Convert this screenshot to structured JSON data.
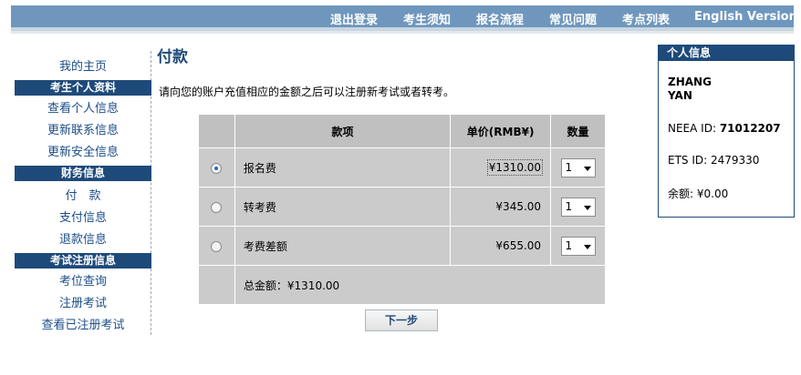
{
  "nav": {
    "items": [
      "退出登录",
      "考生须知",
      "报名流程",
      "常见问题",
      "考点列表"
    ],
    "english_label": "English Version"
  },
  "sidebar": {
    "home": "我的主页",
    "sections": [
      {
        "title": "考生个人资料",
        "links": [
          "查看个人信息",
          "更新联系信息",
          "更新安全信息"
        ]
      },
      {
        "title": "财务信息",
        "links": [
          "付　款",
          "支付信息",
          "退款信息"
        ]
      },
      {
        "title": "考试注册信息",
        "links": [
          "考位查询",
          "注册考试",
          "查看已注册考试"
        ]
      }
    ]
  },
  "main": {
    "title": "付款",
    "intro": "请向您的账户充值相应的金额之后可以注册新考试或者转考。",
    "table": {
      "headers": [
        "款项",
        "单价(RMB¥)",
        "数量"
      ],
      "rows": [
        {
          "item": "报名费",
          "price": "¥1310.00",
          "qty": "1",
          "selected": true
        },
        {
          "item": "转考费",
          "price": "¥345.00",
          "qty": "1",
          "selected": false
        },
        {
          "item": "考费差额",
          "price": "¥655.00",
          "qty": "1",
          "selected": false
        }
      ],
      "total": "总金额：¥1310.00"
    },
    "next_button": "下一步"
  },
  "info": {
    "title": "个人信息",
    "name_line1": "ZHANG",
    "name_line2": "YAN",
    "neea_label": "NEEA ID: ",
    "neea_value": "71012207",
    "ets": "ETS ID: 2479330",
    "balance": "余额: ¥0.00"
  }
}
